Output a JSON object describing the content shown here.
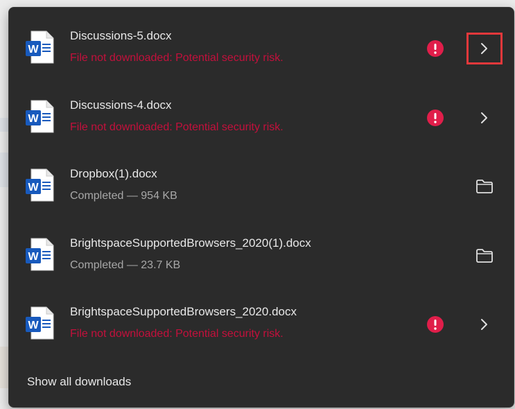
{
  "downloads_panel": {
    "items": [
      {
        "file_name": "Discussions-5.docx",
        "status": "File not downloaded: Potential security risk.",
        "status_type": "error",
        "warning_icon": "error-icon",
        "action_icon": "chevron-right-icon",
        "highlighted": true
      },
      {
        "file_name": "Discussions-4.docx",
        "status": "File not downloaded: Potential security risk.",
        "status_type": "error",
        "warning_icon": "error-icon",
        "action_icon": "chevron-right-icon",
        "highlighted": false
      },
      {
        "file_name": "Dropbox(1).docx",
        "status": "Completed — 954 KB",
        "status_type": "completed",
        "action_icon": "folder-icon"
      },
      {
        "file_name": "BrightspaceSupportedBrowsers_2020(1).docx",
        "status": "Completed — 23.7 KB",
        "status_type": "completed",
        "action_icon": "folder-icon"
      },
      {
        "file_name": "BrightspaceSupportedBrowsers_2020.docx",
        "status": "File not downloaded: Potential security risk.",
        "status_type": "error",
        "warning_icon": "error-icon",
        "action_icon": "chevron-right-icon",
        "highlighted": false
      }
    ],
    "footer_link": "Show all downloads"
  },
  "colors": {
    "panel_background": "#2b2b2b",
    "error_text": "#c4103c",
    "error_icon": "#e01e4a",
    "highlight_border": "#e5383b",
    "word_blue": "#185abd"
  }
}
